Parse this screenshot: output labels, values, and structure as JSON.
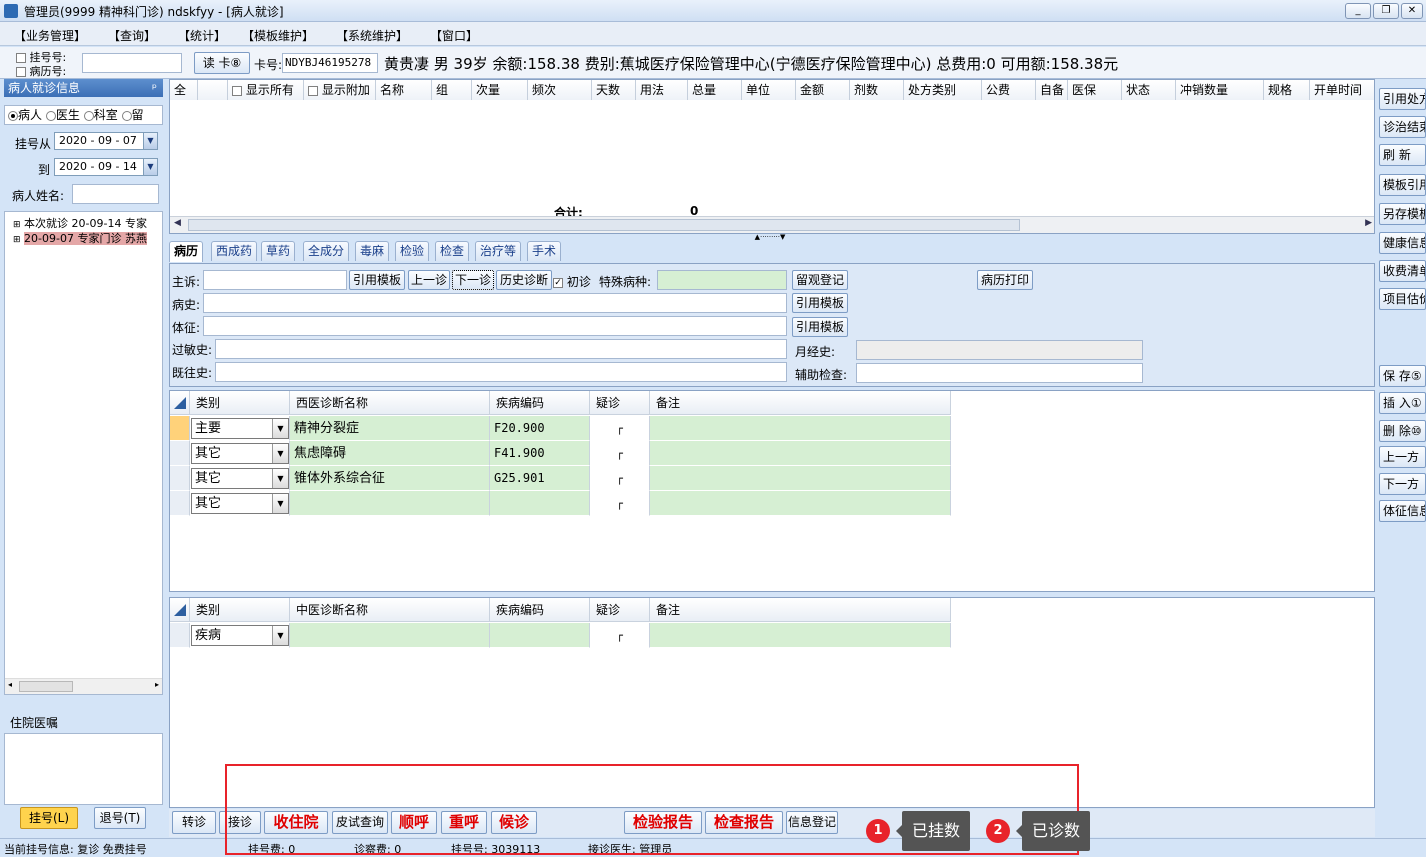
{
  "window": {
    "title": "管理员(9999 精神科门诊) ndskfyy - [病人就诊]",
    "controls": [
      "_",
      "❐",
      "✕"
    ]
  },
  "menu": [
    "【业务管理】",
    "【查询】",
    "【统计】",
    "【模板维护】",
    "【系统维护】",
    "【窗口】"
  ],
  "patient_bar": {
    "reg_no_label": "挂号号:",
    "record_no_label": "病历号:",
    "read_card": "读 卡⑧",
    "card_label": "卡号:",
    "card_no": "NDYBJ46195278",
    "info": "黄贵凄  男  39岁  余额:158.38  费别:蕉城医疗保险管理中心(宁德医疗保险管理中心)  总费用:0  可用额:158.38元"
  },
  "left": {
    "header": "病人就诊信息",
    "pin": "ᵖ",
    "radios": [
      "病人",
      "医生",
      "科室",
      "留"
    ],
    "from_label": "挂号从",
    "from_date": "2020 - 09 - 07",
    "to_label": "到",
    "to_date": "2020 - 09 - 14",
    "name_label": "病人姓名:",
    "tree": [
      "本次就诊 20-09-14 专家",
      "20-09-07 专家门诊 苏燕"
    ],
    "inpatient_header": "住院医嘱",
    "btn_register": "挂号(L)",
    "btn_unregister": "退号(T)"
  },
  "rx_grid": {
    "headers": [
      "全",
      "",
      "显示所有",
      "显示附加",
      "名称",
      "组",
      "次量",
      "频次",
      "天数",
      "用法",
      "总量",
      "单位",
      "金额",
      "剂数",
      "处方类别",
      "公费",
      "自备",
      "医保",
      "状态",
      "冲销数量",
      "规格",
      "开单时间"
    ],
    "total_label": "合计:",
    "total_value": "0"
  },
  "tabs": [
    "病历",
    "西成药",
    "草药",
    "全成分",
    "毒麻",
    "检验",
    "检查",
    "治疗等",
    "手术"
  ],
  "record": {
    "complaint_label": "主诉:",
    "btn_cite_template": "引用模板",
    "btn_prev": "上一诊",
    "btn_next": "下一诊",
    "btn_history": "历史诊断",
    "first_visit": "初诊",
    "special_label": "特殊病种:",
    "btn_observe": "留观登记",
    "btn_print": "病历打印",
    "history_label": "病史:",
    "sign_label": "体征:",
    "allergy_label": "过敏史:",
    "past_label": "既往史:",
    "menses_label": "月经史:",
    "aux_label": "辅助检查:"
  },
  "west_diag": {
    "headers": [
      "类别",
      "西医诊断名称",
      "疾病编码",
      "疑诊",
      "备注"
    ],
    "rows": [
      {
        "type": "主要",
        "name": "精神分裂症",
        "code": "F20.900",
        "doubt": "┌"
      },
      {
        "type": "其它",
        "name": "焦虑障碍",
        "code": "F41.900",
        "doubt": "┌"
      },
      {
        "type": "其它",
        "name": "锥体外系综合征",
        "code": "G25.901",
        "doubt": "┌"
      },
      {
        "type": "其它",
        "name": "",
        "code": "",
        "doubt": "┌"
      }
    ]
  },
  "tcm_diag": {
    "headers": [
      "类别",
      "中医诊断名称",
      "疾病编码",
      "疑诊",
      "备注"
    ],
    "rows": [
      {
        "type": "疾病",
        "name": "",
        "code": "",
        "doubt": "┌"
      }
    ]
  },
  "right_buttons": [
    "引用处方",
    "诊治结束",
    "刷 新",
    "模板引用",
    "另存模板",
    "健康信息",
    "收费清单",
    "项目估价",
    "保 存⑤",
    "插 入①",
    "删 除⑩",
    "上一方",
    "下一方",
    "体征信息"
  ],
  "bottom_buttons": {
    "transfer": "转诊",
    "receive": "接诊",
    "admit": "收住院",
    "skin_test": "皮试查询",
    "call": "顺呼",
    "recall": "重呼",
    "wait": "候诊",
    "lab_report": "检验报告",
    "exam_report": "检查报告",
    "info_reg": "信息登记"
  },
  "annotations": [
    {
      "num": "1",
      "text": "已挂数"
    },
    {
      "num": "2",
      "text": "已诊数"
    }
  ],
  "status_bar": {
    "current_reg": "当前挂号信息:  复诊 免费挂号",
    "reg_fee": "挂号费:  0",
    "diag_fee": "诊察费:  0",
    "reg_no": "挂号号:  3039113",
    "doctor": "接诊医生:  管理员"
  },
  "colors": {
    "highlight_red": "#e8232a",
    "green_cell": "#d6efd3",
    "panel_blue": "#d4e4f7"
  }
}
